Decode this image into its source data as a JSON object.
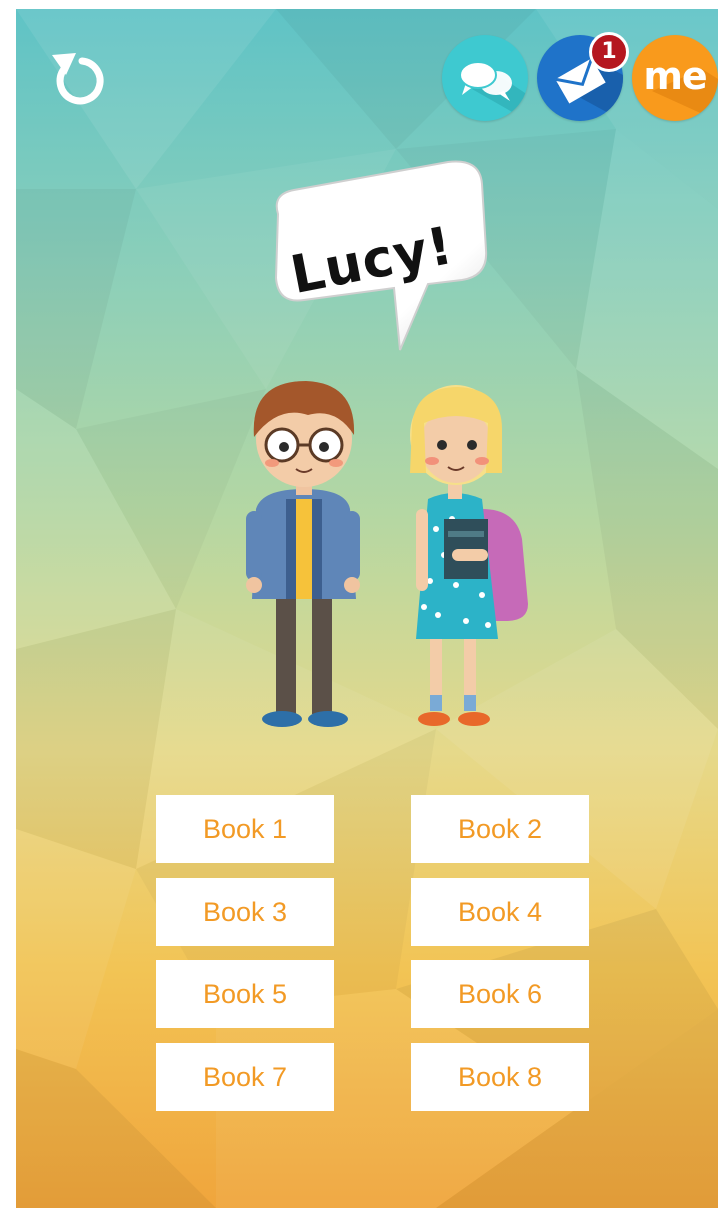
{
  "speech_bubble": {
    "text": "Lucy!"
  },
  "header": {
    "me_label": "me",
    "mail_badge": "1"
  },
  "icons": {
    "refresh": "refresh-icon",
    "chat": "chat-bubbles-icon",
    "mail": "envelope-icon",
    "me": "me-profile-icon"
  },
  "colors": {
    "chat_button": "#3ec9d0",
    "mail_button": "#1f73c9",
    "me_button": "#f99a1c",
    "badge": "#b5171f",
    "book_text": "#f29a25"
  },
  "books": [
    "Book 1",
    "Book 2",
    "Book 3",
    "Book 4",
    "Book 5",
    "Book 6",
    "Book 7",
    "Book 8"
  ]
}
